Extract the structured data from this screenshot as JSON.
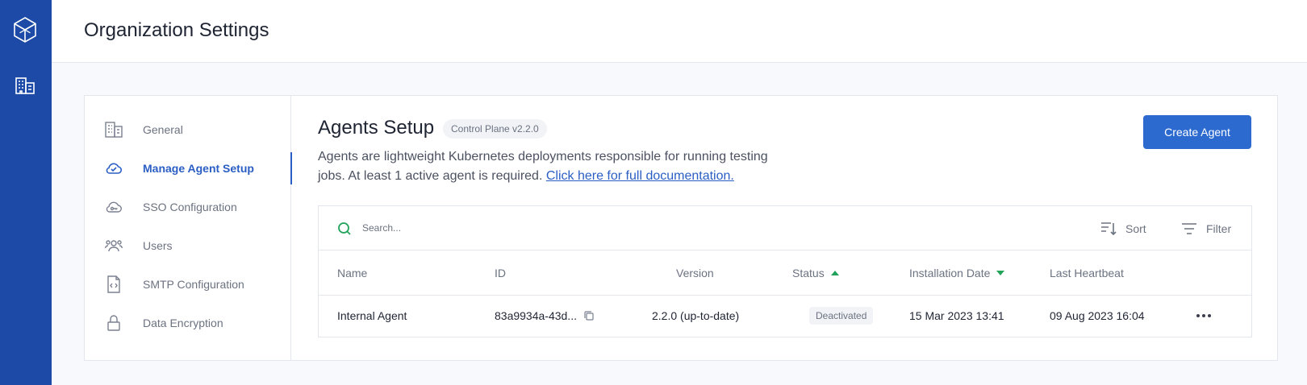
{
  "page": {
    "title": "Organization Settings"
  },
  "rail": {
    "logo_icon": "hexagon-cube-logo-icon",
    "org_icon": "building-icon"
  },
  "sidebar": {
    "items": [
      {
        "label": "General",
        "icon": "building-icon",
        "active": false
      },
      {
        "label": "Manage Agent Setup",
        "icon": "cloud-check-icon",
        "active": true
      },
      {
        "label": "SSO Configuration",
        "icon": "cloud-key-icon",
        "active": false
      },
      {
        "label": "Users",
        "icon": "users-icon",
        "active": false
      },
      {
        "label": "SMTP Configuration",
        "icon": "file-code-icon",
        "active": false
      },
      {
        "label": "Data Encryption",
        "icon": "lock-icon",
        "active": false
      }
    ]
  },
  "agents": {
    "heading": "Agents Setup",
    "version_pill": "Control Plane v2.2.0",
    "description": "Agents are lightweight Kubernetes deployments responsible for running testing jobs. At least 1 active agent is required.",
    "doc_link": "Click here for full documentation.",
    "create_button": "Create Agent"
  },
  "table": {
    "search_placeholder": "Search...",
    "sort_label": "Sort",
    "filter_label": "Filter",
    "columns": {
      "name": "Name",
      "id": "ID",
      "version": "Version",
      "status": "Status",
      "installation_date": "Installation Date",
      "last_heartbeat": "Last Heartbeat"
    },
    "rows": [
      {
        "name": "Internal Agent",
        "id": "83a9934a-43d...",
        "version": "2.2.0 (up-to-date)",
        "status": "Deactivated",
        "installation_date": "15 Mar 2023 13:41",
        "last_heartbeat": "09 Aug 2023 16:04"
      }
    ]
  },
  "colors": {
    "rail": "#1c4aa6",
    "accent": "#2b5ec4",
    "button": "#2d6ad0",
    "sort_arrow": "#22a35a",
    "search_icon": "#22a35a"
  }
}
